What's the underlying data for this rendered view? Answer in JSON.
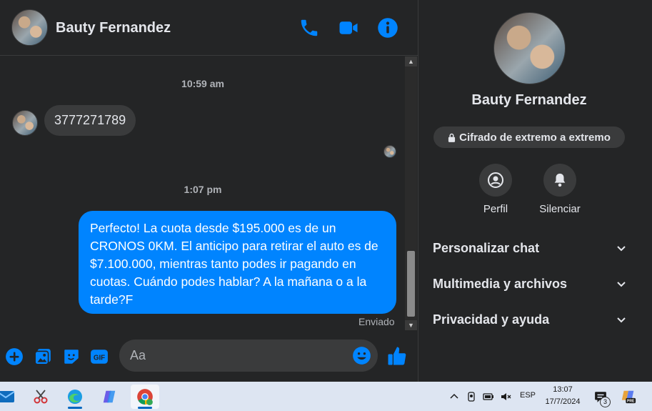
{
  "header": {
    "name": "Bauty Fernandez"
  },
  "messages": {
    "timestamp_1": "10:59 am",
    "incoming_text": "3777271789",
    "timestamp_2": "1:07 pm",
    "outgoing_text": "Perfecto! La cuota desde $195.000 es de un CRONOS 0KM. El anticipo para retirar el auto es de $7.100.000, mientras tanto podes ir pagando en cuotas. Cuándo podes hablar? A la mañana o a la tarde?F",
    "status": "Enviado"
  },
  "composer": {
    "placeholder": "Aa"
  },
  "panel": {
    "name": "Bauty Fernandez",
    "encryption": "Cifrado de extremo a extremo",
    "actions": {
      "profile": "Perfil",
      "mute": "Silenciar"
    },
    "sections": [
      "Personalizar chat",
      "Multimedia y archivos",
      "Privacidad y ayuda"
    ]
  },
  "taskbar": {
    "language": "ESP",
    "time": "13:07",
    "date": "17/7/2024",
    "notifications": "3"
  },
  "colors": {
    "accent": "#0084ff",
    "background": "#242526",
    "bubble_incoming": "#3a3b3c"
  },
  "icons": [
    "phone-icon",
    "video-icon",
    "info-icon",
    "add-icon",
    "image-icon",
    "sticker-icon",
    "gif-icon",
    "emoji-icon",
    "like-icon",
    "lock-icon",
    "profile-icon",
    "bell-icon",
    "chevron-down-icon"
  ]
}
